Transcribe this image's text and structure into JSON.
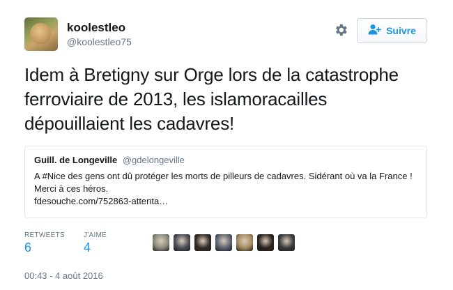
{
  "user": {
    "name": "koolestleo",
    "handle": "@koolestleo75",
    "avatar_icon": "lion-cub-avatar"
  },
  "actions": {
    "settings_icon": "gear-icon",
    "follow_label": "Suivre",
    "follow_icon": "follow-person-plus-icon"
  },
  "tweet": {
    "text": "Idem à Bretigny sur Orge lors de la catastrophe\nferroviaire de 2013, les islamoracailles\ndépouillaient les cadavres!"
  },
  "quoted": {
    "name": "Guill. de Longeville",
    "handle": "@gdelongeville",
    "text": "A #Nice des gens ont dû protéger les morts de pilleurs de cadavres. Sidérant où va la France ! Merci à ces héros.",
    "link": "fdesouche.com/752863-attenta…"
  },
  "stats": {
    "retweets_label": "RETWEETS",
    "retweets_count": "6",
    "likes_label": "J'AIME",
    "likes_count": "4"
  },
  "likers": [
    {
      "icon": "liker-avatar-1",
      "color": "#8a8a7e"
    },
    {
      "icon": "liker-avatar-2",
      "color": "#4a4d52"
    },
    {
      "icon": "liker-avatar-3",
      "color": "#2f2a26"
    },
    {
      "icon": "liker-avatar-4",
      "color": "#5b6170"
    },
    {
      "icon": "liker-avatar-5",
      "color": "#a58a5f"
    },
    {
      "icon": "liker-avatar-6",
      "color": "#2b2220"
    },
    {
      "icon": "liker-avatar-7",
      "color": "#3a3a3a"
    }
  ],
  "timestamp": "00:43 - 4 août 2016",
  "colors": {
    "accent": "#1b95e0",
    "muted": "#657786",
    "border": "#e1e8ed"
  }
}
